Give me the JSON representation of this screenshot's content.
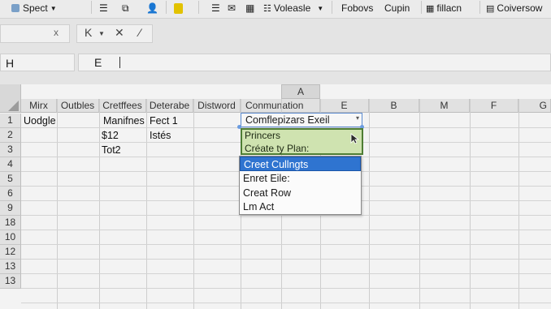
{
  "ribbon": {
    "spect": "Spect",
    "voleasle": "Voleasle",
    "fobovs": "Fobovs",
    "cupin": "Cupin",
    "fillacn": "fillacn",
    "coiversow": "Coiversow"
  },
  "toolbar": {
    "namebox_close": "x",
    "btn_k": "K",
    "btn_x": "✕",
    "btn_fx": "⁄"
  },
  "formula_bar": {
    "address": "H",
    "content": "E"
  },
  "columns": {
    "top_header": "A",
    "headers": [
      "Mirx",
      "Outbles",
      "Cretffees",
      "Deterabe",
      "Distword",
      "Conmunation",
      "E",
      "B",
      "M",
      "F",
      "G"
    ]
  },
  "rows": {
    "numbers": [
      "1",
      "2",
      "3",
      "4",
      "5",
      "6",
      "9",
      "18",
      "10",
      "12",
      "13",
      "13"
    ]
  },
  "cells": {
    "a1": "Uodgle",
    "c1": "Manifnes",
    "d1": "Fect 1",
    "c2": "$12",
    "d2": "Istés",
    "c3": "Tot2"
  },
  "active_cell": {
    "value": "Comflepizars Exeil"
  },
  "suggestion": {
    "line1": "Princers",
    "line2": "Créate ty Plan:"
  },
  "dropdown": {
    "items": [
      "Creet Cullngts",
      "Enret Eile:",
      "Creat Row",
      "Lm Act"
    ],
    "selected_index": 0
  },
  "colors": {
    "selection_blue": "#2f74d0",
    "suggestion_green": "#cfe3b0",
    "suggestion_border": "#4e7d34"
  }
}
